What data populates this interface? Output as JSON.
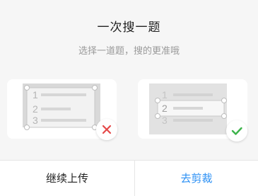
{
  "dialog": {
    "title": "一次搜一题",
    "subtitle": "选择一道题，搜的更准哦"
  },
  "examples": {
    "wrong": {
      "numbers": [
        "1",
        "2",
        "3"
      ],
      "result_icon": "cross-icon",
      "result_color": "#e54848"
    },
    "right": {
      "numbers": [
        "1",
        "2",
        "3"
      ],
      "result_icon": "check-icon",
      "result_color": "#3cb34a"
    }
  },
  "footer": {
    "continue_label": "继续上传",
    "crop_label": "去剪裁",
    "crop_color": "#2a8ff4"
  }
}
